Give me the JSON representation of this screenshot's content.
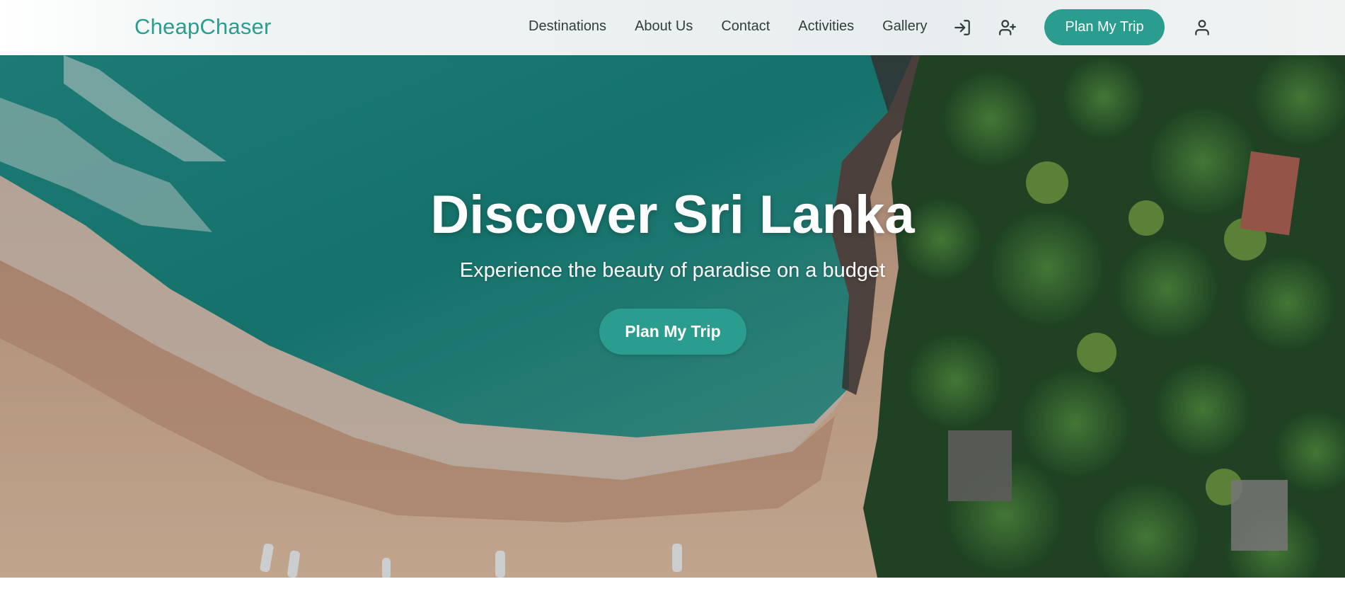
{
  "brand": {
    "name": "CheapChaser",
    "color": "#2a9d8f"
  },
  "nav": {
    "links": [
      {
        "label": "Destinations"
      },
      {
        "label": "About Us"
      },
      {
        "label": "Contact"
      },
      {
        "label": "Activities"
      },
      {
        "label": "Gallery"
      }
    ],
    "icons": {
      "login": "login-icon",
      "register": "user-plus-icon",
      "profile": "user-icon"
    },
    "cta_label": "Plan My Trip"
  },
  "hero": {
    "title": "Discover Sri Lanka",
    "subtitle": "Experience the beauty of paradise on a budget",
    "cta_label": "Plan My Trip",
    "image": "aerial-beach-forest-image"
  },
  "colors": {
    "accent": "#2a9d8f",
    "text_dark": "#333c3b",
    "text_light": "#ffffff"
  }
}
